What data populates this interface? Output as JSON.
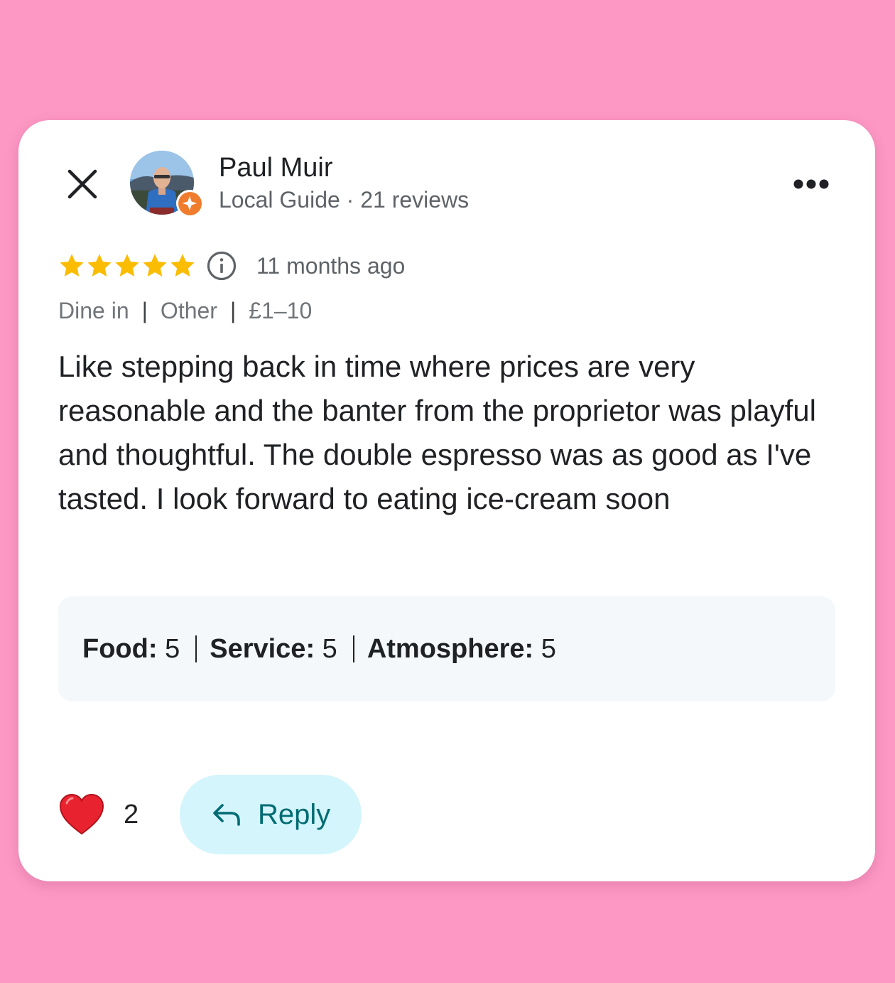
{
  "author": {
    "name": "Paul Muir",
    "meta": "Local Guide · 21 reviews",
    "avatar_icon": "profile-photo",
    "badge_icon": "local-guide-star-badge"
  },
  "review": {
    "rating": 5,
    "max_rating": 5,
    "time_ago": "11 months ago",
    "attributes": [
      "Dine in",
      "Other",
      "£1–10"
    ],
    "text": "Like stepping back in time where prices are very reasonable and the banter from the proprietor was playful and thoughtful. The double espresso was as good as I've tasted. I look forward to eating ice-cream soon"
  },
  "scores": [
    {
      "label": "Food:",
      "value": "5"
    },
    {
      "label": "Service:",
      "value": "5"
    },
    {
      "label": "Atmosphere:",
      "value": "5"
    }
  ],
  "footer": {
    "like_count": "2",
    "reply_label": "Reply"
  },
  "colors": {
    "background": "#fd97c4",
    "star": "#fbbc04",
    "badge": "#f07c2e",
    "reply_bg": "#d3f5fb",
    "reply_fg": "#006b73"
  }
}
